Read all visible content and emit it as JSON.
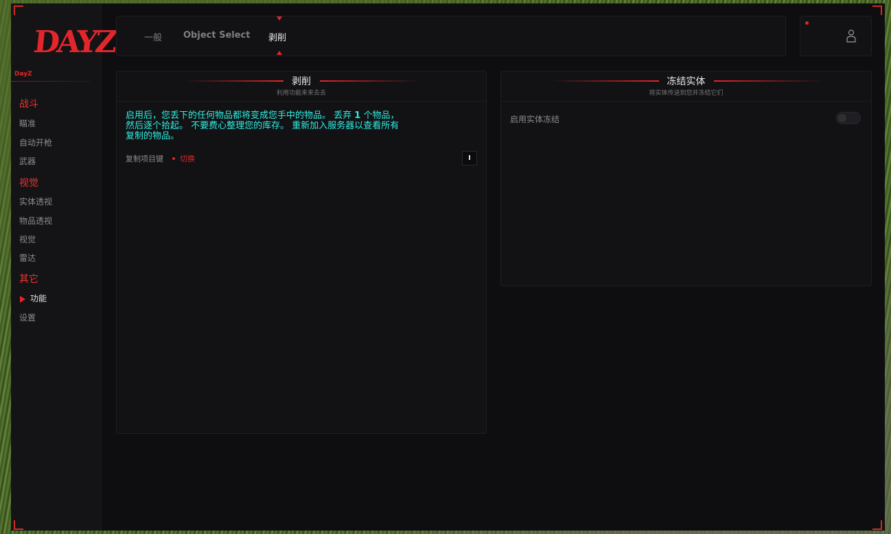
{
  "sidebar": {
    "logo": "DAYZ",
    "logo_sub": "DayZ",
    "categories": [
      {
        "label": "战斗",
        "items": [
          "瞄准",
          "自动开枪",
          "武器"
        ]
      },
      {
        "label": "视觉",
        "items": [
          "实体透视",
          "物品透视",
          "视觉",
          "雷达"
        ]
      },
      {
        "label": "其它",
        "items": [
          "功能",
          "设置"
        ]
      }
    ],
    "active_item": "功能"
  },
  "tabs": [
    {
      "label": "一般"
    },
    {
      "label": "Object Select"
    },
    {
      "label": "剥削"
    }
  ],
  "active_tab": "剥削",
  "panels": {
    "exploit": {
      "title": "剥削",
      "subtitle": "利用功能来来去去",
      "description_parts": [
        "启用后，您丢下的任何物品都将变成您手中的物品。 丢弃 ",
        "1",
        " 个物品，然后逐个拾起。 不要费心整理您的库存。 重新加入服务器以查看所有复制的物品。"
      ],
      "hotkey_label": "复制项目键",
      "hotkey_mode": "切换",
      "hotkey_key": "I"
    },
    "freeze": {
      "title": "冻结实体",
      "subtitle": "将实体传送到您并冻结它们",
      "option_label": "启用实体冻结",
      "option_enabled": false
    }
  },
  "colors": {
    "accent": "#e3262b",
    "description": "#2ff0e6",
    "background": "#0e0e10"
  }
}
